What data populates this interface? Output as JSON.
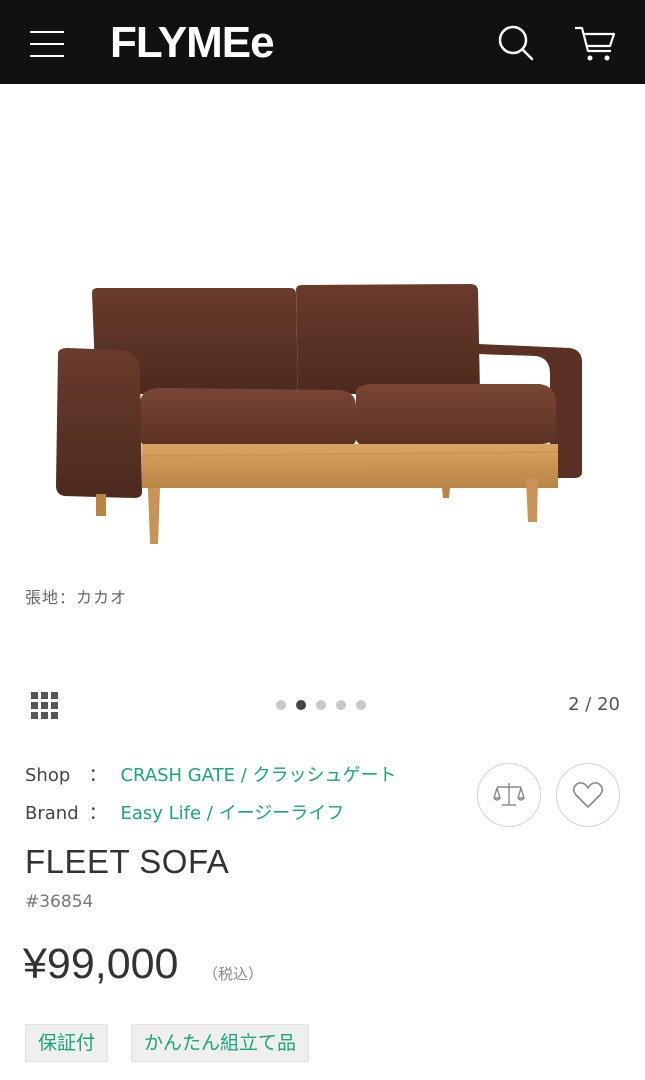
{
  "header": {
    "logo": "FLYMEe",
    "menu_icon": "hamburger-menu-icon",
    "search_icon": "search-icon",
    "cart_icon": "cart-icon",
    "background": "#111111"
  },
  "image": {
    "caption": "張地：カカオ",
    "subject": "sofa-photo"
  },
  "gallery": {
    "grid_icon": "grid-icon",
    "dots": 5,
    "active_dot": 1,
    "page_label": "2 / 20"
  },
  "product": {
    "shop_label": "Shop",
    "shop_sep": "：",
    "shop_value": "CRASH GATE / クラッシュゲート",
    "brand_label": "Brand",
    "brand_sep": "：",
    "brand_value": "Easy Life / イージーライフ",
    "compare_icon": "scale-compare-icon",
    "favorite_icon": "heart-icon",
    "name": "FLEET SOFA",
    "id": "#36854",
    "price": "¥99,000",
    "tax_note": "（税込）",
    "badges": [
      "保証付",
      "かんたん組立て品"
    ]
  },
  "colors": {
    "accent": "#1aa57a",
    "badge_bg": "#eff0ee",
    "dot_active": "#444444",
    "dot_inactive": "#c8c8cc"
  }
}
